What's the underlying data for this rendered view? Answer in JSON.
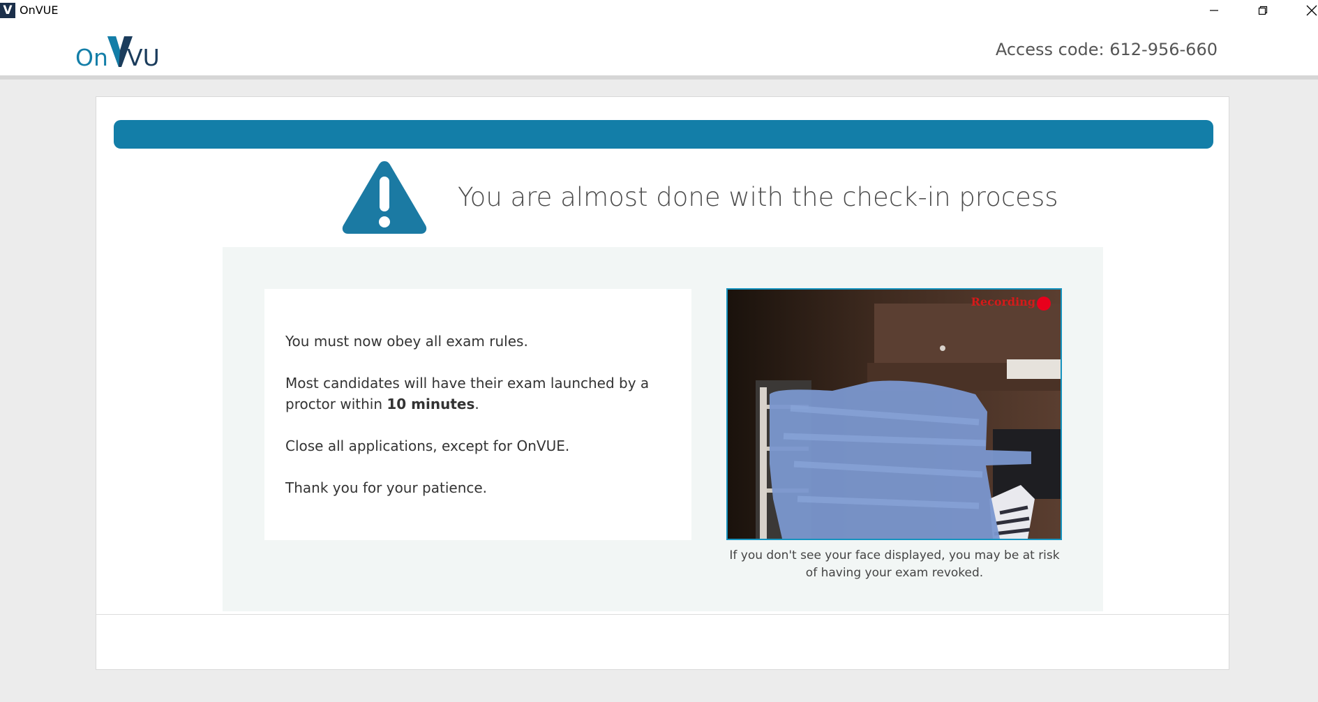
{
  "window": {
    "icon_letter": "V",
    "title": "OnVUE",
    "minimize_icon": "minimize-icon",
    "restore_icon": "restore-icon",
    "close_icon": "close-icon"
  },
  "header": {
    "logo_text_on": "On",
    "logo_text_vue": "VUE",
    "access_code": "Access code: 612-956-660"
  },
  "checkin": {
    "progress": 1.0,
    "progress_color": "#137ea8",
    "warning_icon": "warning-triangle-icon",
    "heading": "You are almost done with the check-in process",
    "rules": {
      "line1": "You must now obey all exam rules.",
      "line2_prefix": "Most candidates will have their exam launched by a proctor within ",
      "line2_bold": "10 minutes",
      "line2_suffix": ".",
      "line3": "Close all applications, except for OnVUE.",
      "line4": "Thank you for your patience."
    },
    "webcam": {
      "recording_label": "Recording",
      "note": "If you don't see your face displayed, you may be at risk of having your exam revoked."
    }
  },
  "colors": {
    "accent": "#137ea8",
    "recording_red": "#e8001c",
    "panel_bg": "#f2f6f5",
    "page_bg": "#ececec"
  }
}
